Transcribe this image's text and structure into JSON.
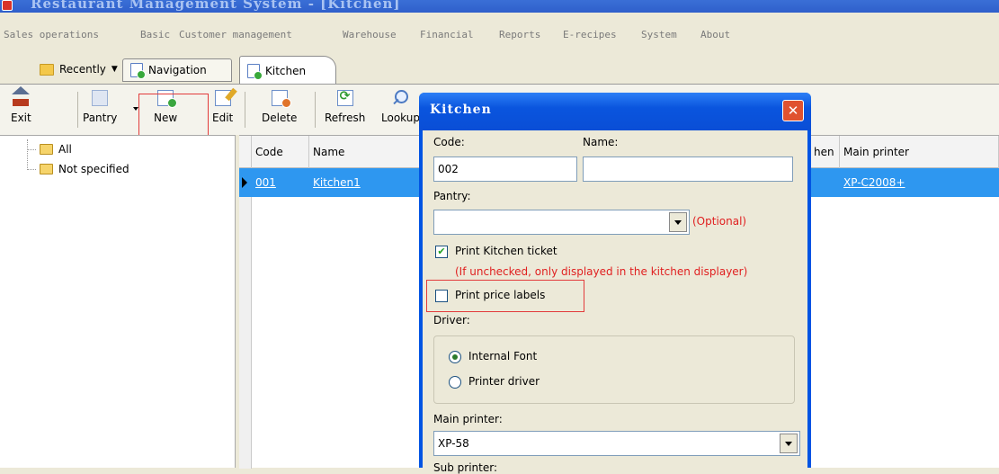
{
  "window": {
    "title": "Restaurant Management System - [Kitchen]"
  },
  "menu": [
    "Sales operations",
    "Basic",
    "Customer management",
    "Warehouse",
    "Financial",
    "Reports",
    "E-recipes",
    "System",
    "About"
  ],
  "tabs": {
    "recently": "Recently",
    "navigation": "Navigation",
    "kitchen": "Kitchen"
  },
  "toolbar": {
    "exit": "Exit",
    "pantry": "Pantry",
    "new": "New",
    "edit": "Edit",
    "delete": "Delete",
    "refresh": "Refresh",
    "lookup": "Lookup"
  },
  "tree": {
    "items": [
      "All",
      "Not specified"
    ]
  },
  "grid": {
    "headers": {
      "code": "Code",
      "name": "Name",
      "kitchen_partial": "hen",
      "main_printer": "Main printer"
    },
    "rows": [
      {
        "code": "001",
        "name": "Kitchen1",
        "main_printer": "XP-C2008+"
      }
    ]
  },
  "dialog": {
    "title": "Kitchen",
    "close_glyph": "✕",
    "code_label": "Code:",
    "code_value": "002",
    "name_label": "Name:",
    "name_value": "",
    "pantry_label": "Pantry:",
    "pantry_value": "",
    "optional_text": "(Optional)",
    "print_ticket_label": "Print Kitchen ticket",
    "print_ticket_checked": true,
    "print_ticket_note": "(If unchecked, only displayed in the kitchen displayer)",
    "print_price_label": "Print price labels",
    "print_price_checked": false,
    "driver_label": "Driver:",
    "driver_options": [
      "Internal Font",
      "Printer driver"
    ],
    "driver_selected": "Internal Font",
    "main_printer_label": "Main printer:",
    "main_printer_value": "XP-58",
    "sub_printer_label": "Sub printer:"
  },
  "colors": {
    "selection": "#2e97f0",
    "dialog_frame": "#0054e3",
    "highlight_box": "#e23b3b",
    "note_text": "#e02020"
  }
}
